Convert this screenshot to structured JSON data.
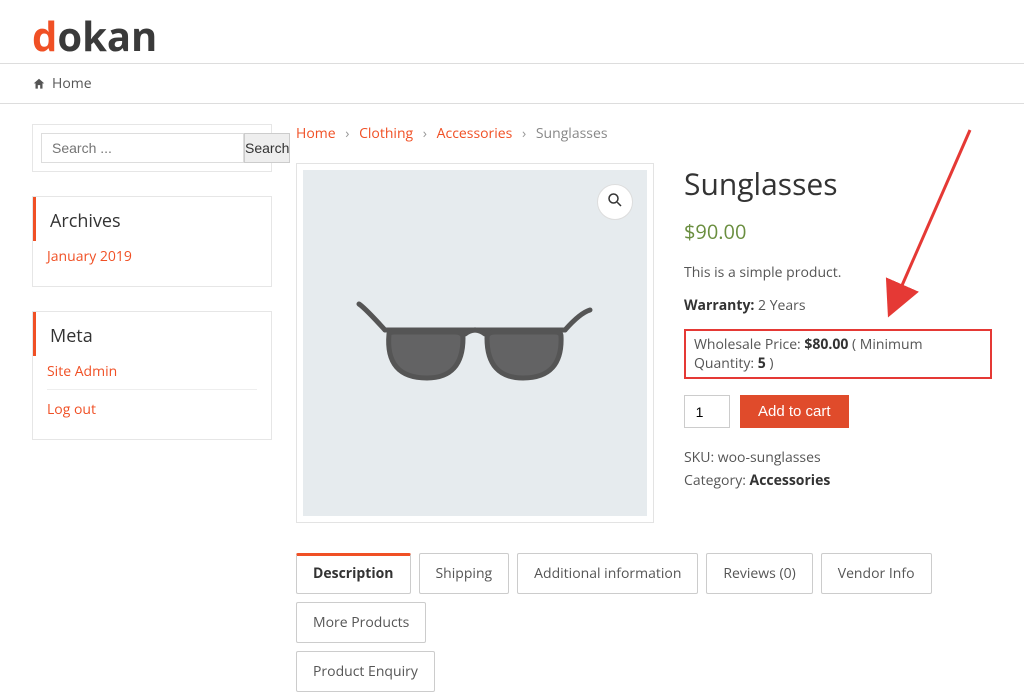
{
  "logo": {
    "initial": "d",
    "rest": "okan"
  },
  "nav": {
    "home_label": "Home"
  },
  "search": {
    "placeholder": "Search ...",
    "button": "Search"
  },
  "archives": {
    "title": "Archives",
    "items": [
      "January 2019"
    ]
  },
  "meta": {
    "title": "Meta",
    "items": [
      "Site Admin",
      "Log out"
    ]
  },
  "breadcrumb": {
    "links": [
      "Home",
      "Clothing",
      "Accessories"
    ],
    "current": "Sunglasses",
    "sep": "›"
  },
  "product": {
    "title": "Sunglasses",
    "price": "$90.00",
    "short_description": "This is a simple product.",
    "warranty_label": "Warranty:",
    "warranty_value": "2 Years",
    "wholesale": {
      "prefix": "Wholesale Price: ",
      "price": "$80.00",
      "mid": " ( Minimum Quantity: ",
      "qty": "5",
      "suffix": " )"
    },
    "add_to_cart": "Add to cart",
    "qty_value": "1",
    "sku_label": "SKU:",
    "sku_value": "woo-sunglasses",
    "cat_label": "Category:",
    "cat_value": "Accessories"
  },
  "tabs": {
    "row1": [
      "Description",
      "Shipping",
      "Additional information",
      "Reviews (0)",
      "Vendor Info",
      "More Products"
    ],
    "row2": [
      "Product Enquiry"
    ],
    "active": "Description"
  }
}
